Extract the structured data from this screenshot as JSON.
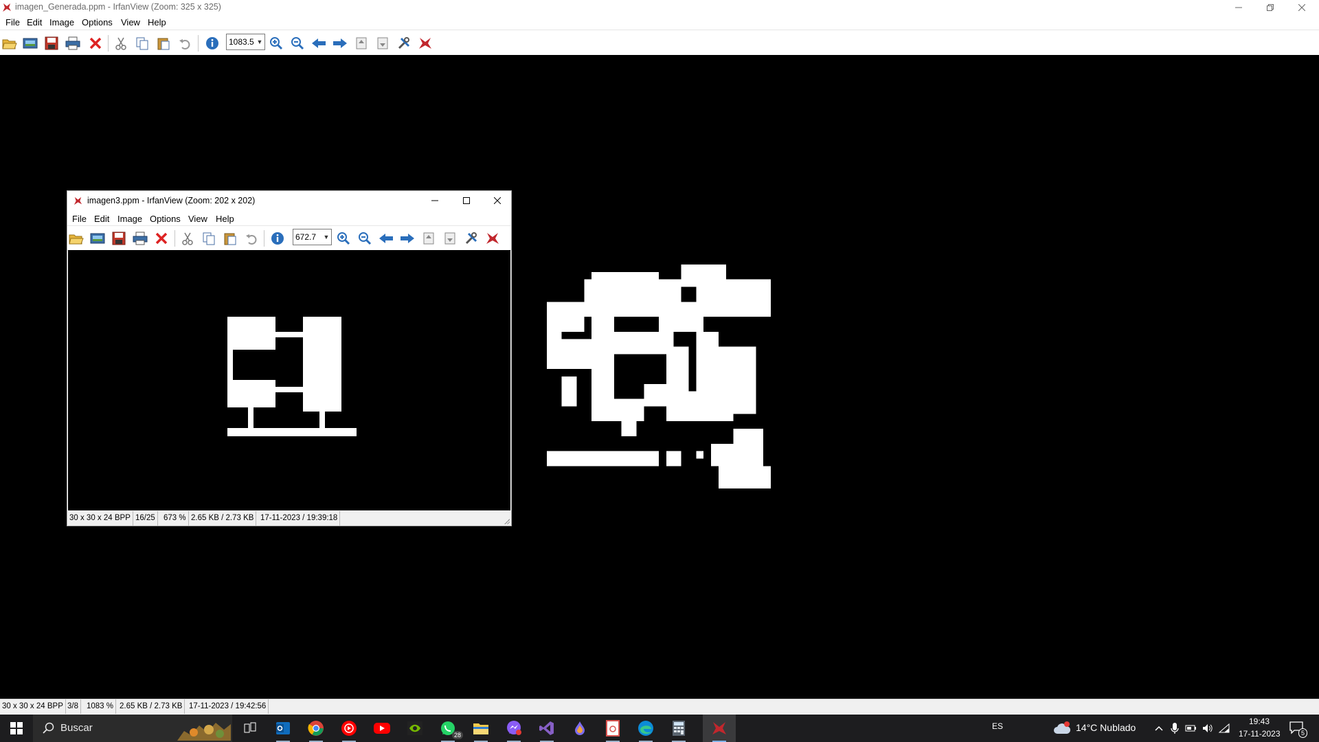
{
  "main_window": {
    "title": "imagen_Generada.ppm - IrfanView (Zoom: 325 x 325)",
    "menu": [
      "File",
      "Edit",
      "Image",
      "Options",
      "View",
      "Help"
    ],
    "zoom_value": "1083.5",
    "toolbar_icons": [
      "open-folder-icon",
      "slideshow-icon",
      "save-icon",
      "print-icon",
      "delete-icon",
      "cut-icon",
      "copy-icon",
      "paste-icon",
      "undo-icon",
      "info-icon",
      "zoom-in-icon",
      "zoom-out-icon",
      "previous-icon",
      "next-icon",
      "first-page-icon",
      "last-page-icon",
      "settings-icon",
      "irfanview-logo-icon"
    ],
    "status": [
      "30 x 30 x 24 BPP",
      "3/8",
      "1083 %",
      "2.65 KB / 2.73 KB",
      "17-11-2023 / 19:42:56"
    ]
  },
  "child_window": {
    "title": "imagen3.ppm - IrfanView (Zoom: 202 x 202)",
    "menu": [
      "File",
      "Edit",
      "Image",
      "Options",
      "View",
      "Help"
    ],
    "zoom_value": "672.7",
    "status": [
      "30 x 30 x 24 BPP",
      "16/25",
      "673 %",
      "2.65 KB / 2.73 KB",
      "17-11-2023 / 19:39:18"
    ]
  },
  "taskbar": {
    "search_placeholder": "Buscar",
    "apps": [
      "task-view-icon",
      "outlook-icon",
      "chrome-icon",
      "youtube-music-icon",
      "youtube-icon",
      "nvidia-icon",
      "whatsapp-icon",
      "file-explorer-icon",
      "messenger-icon",
      "visual-studio-icon",
      "paint-drop-icon",
      "pdf-icon",
      "edge-icon",
      "calculator-icon",
      "irfanview-icon"
    ],
    "whatsapp_badge": "28",
    "language": "ES",
    "weather": "14°C  Nublado",
    "time": "19:43",
    "date": "17-11-2023",
    "notifications": "5"
  },
  "colors": {
    "canvas": "#000000",
    "taskbar": "#1d1d1f",
    "window": "#ffffff",
    "statusbar": "#f0f0f0"
  }
}
